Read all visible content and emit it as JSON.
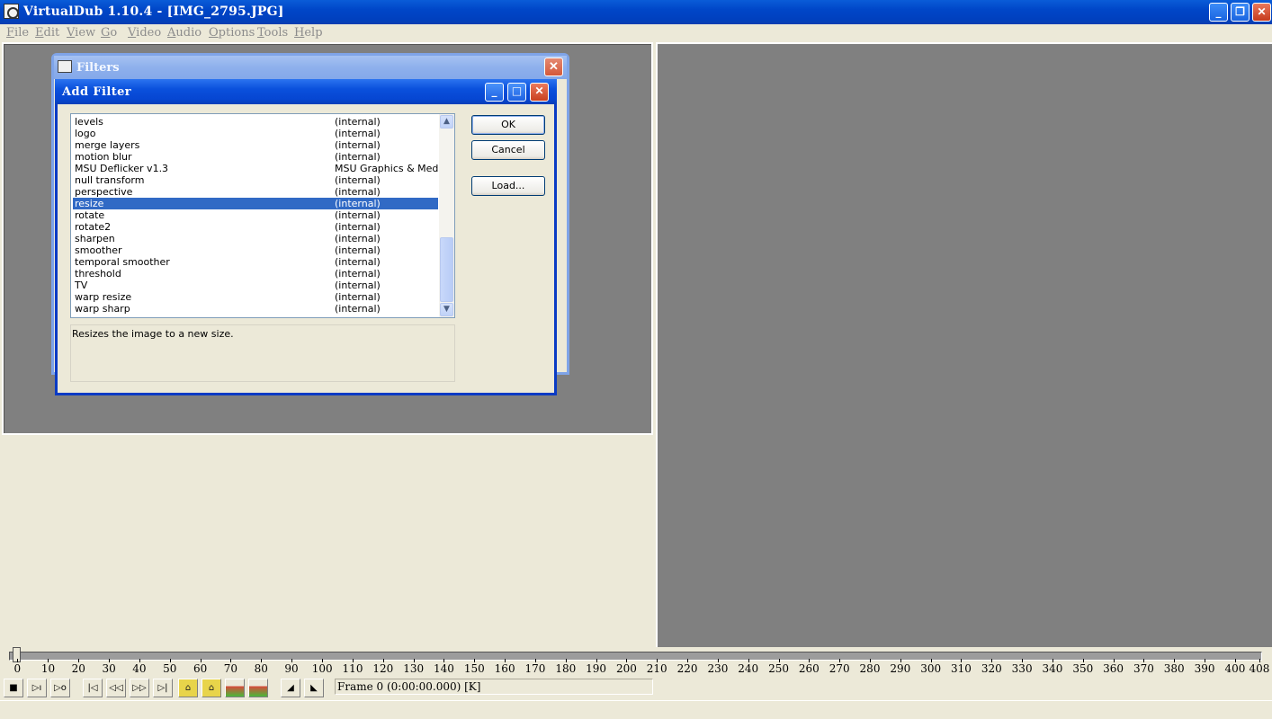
{
  "window": {
    "title": "VirtualDub 1.10.4 - [IMG_2795.JPG]"
  },
  "menu": [
    "File",
    "Edit",
    "View",
    "Go",
    "Video",
    "Audio",
    "Options",
    "Tools",
    "Help"
  ],
  "filters_dialog": {
    "title": "Filters"
  },
  "add_filter_dialog": {
    "title": "Add Filter",
    "items": [
      {
        "name": "levels",
        "source": "(internal)"
      },
      {
        "name": "logo",
        "source": "(internal)"
      },
      {
        "name": "merge layers",
        "source": "(internal)"
      },
      {
        "name": "motion blur",
        "source": "(internal)"
      },
      {
        "name": "MSU Deflicker v1.3",
        "source": "MSU Graphics & Media"
      },
      {
        "name": "null transform",
        "source": "(internal)"
      },
      {
        "name": "perspective",
        "source": "(internal)"
      },
      {
        "name": "resize",
        "source": "(internal)"
      },
      {
        "name": "rotate",
        "source": "(internal)"
      },
      {
        "name": "rotate2",
        "source": "(internal)"
      },
      {
        "name": "sharpen",
        "source": "(internal)"
      },
      {
        "name": "smoother",
        "source": "(internal)"
      },
      {
        "name": "temporal smoother",
        "source": "(internal)"
      },
      {
        "name": "threshold",
        "source": "(internal)"
      },
      {
        "name": "TV",
        "source": "(internal)"
      },
      {
        "name": "warp resize",
        "source": "(internal)"
      },
      {
        "name": "warp sharp",
        "source": "(internal)"
      }
    ],
    "selected": "resize",
    "description": "Resizes the image to a new size.",
    "buttons": {
      "ok": "OK",
      "cancel": "Cancel",
      "load": "Load..."
    }
  },
  "timeline": {
    "ticks": [
      "0",
      "10",
      "20",
      "30",
      "40",
      "50",
      "60",
      "70",
      "80",
      "90",
      "100",
      "110",
      "120",
      "130",
      "140",
      "150",
      "160",
      "170",
      "180",
      "190",
      "200",
      "210",
      "220",
      "230",
      "240",
      "250",
      "260",
      "270",
      "280",
      "290",
      "300",
      "310",
      "320",
      "330",
      "340",
      "350",
      "360",
      "370",
      "380",
      "390",
      "400",
      "408"
    ],
    "frame_status": "Frame 0 (0:00:00.000) [K]"
  },
  "icons": {
    "stop": "stop-icon",
    "play_input": "play-input-icon",
    "play_output": "play-output-icon",
    "start": "go-start-icon",
    "prev_frame": "prev-frame-icon",
    "next_frame": "next-frame-icon",
    "end": "go-end-icon",
    "prev_key": "prev-keyframe-icon",
    "next_key": "next-keyframe-icon",
    "scene_prev": "prev-scene-icon",
    "scene_next": "next-scene-icon",
    "mark_in": "mark-in-icon",
    "mark_out": "mark-out-icon"
  }
}
